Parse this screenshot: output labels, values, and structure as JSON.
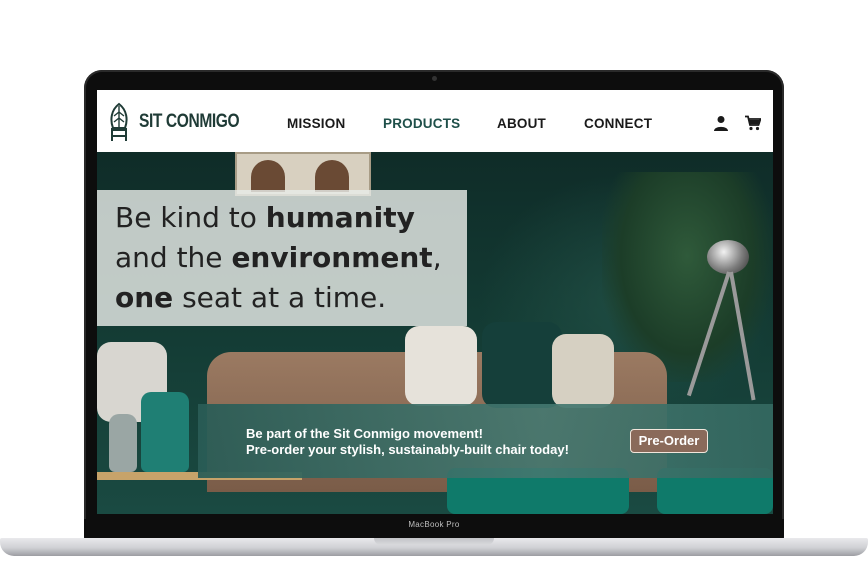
{
  "brand": {
    "name": "SIT CONMIGO",
    "logo_icon": "chair-leaf-logo-icon"
  },
  "nav": {
    "items": [
      {
        "label": "MISSION",
        "active": false
      },
      {
        "label": "PRODUCTS",
        "active": true
      },
      {
        "label": "ABOUT",
        "active": false
      },
      {
        "label": "CONNECT",
        "active": false
      }
    ],
    "active_color": "#1e4f49"
  },
  "header_icons": {
    "account": "user-icon",
    "cart": "cart-icon"
  },
  "hero": {
    "headline": {
      "line1_prefix": "Be kind to ",
      "line1_bold": "humanity",
      "line2_prefix": "and the ",
      "line2_bold": "environment",
      "line2_suffix": ",",
      "line3_bold": "one",
      "line3_suffix": " seat at a time."
    },
    "cta": {
      "line1": "Be part of the Sit Conmigo movement!",
      "line2": "Pre-order your stylish, sustainably-built chair today!",
      "button_label": "Pre-Order",
      "band_color": "#2f6a62",
      "button_color": "#8a6a5a"
    }
  },
  "device": {
    "label": "MacBook Pro"
  }
}
